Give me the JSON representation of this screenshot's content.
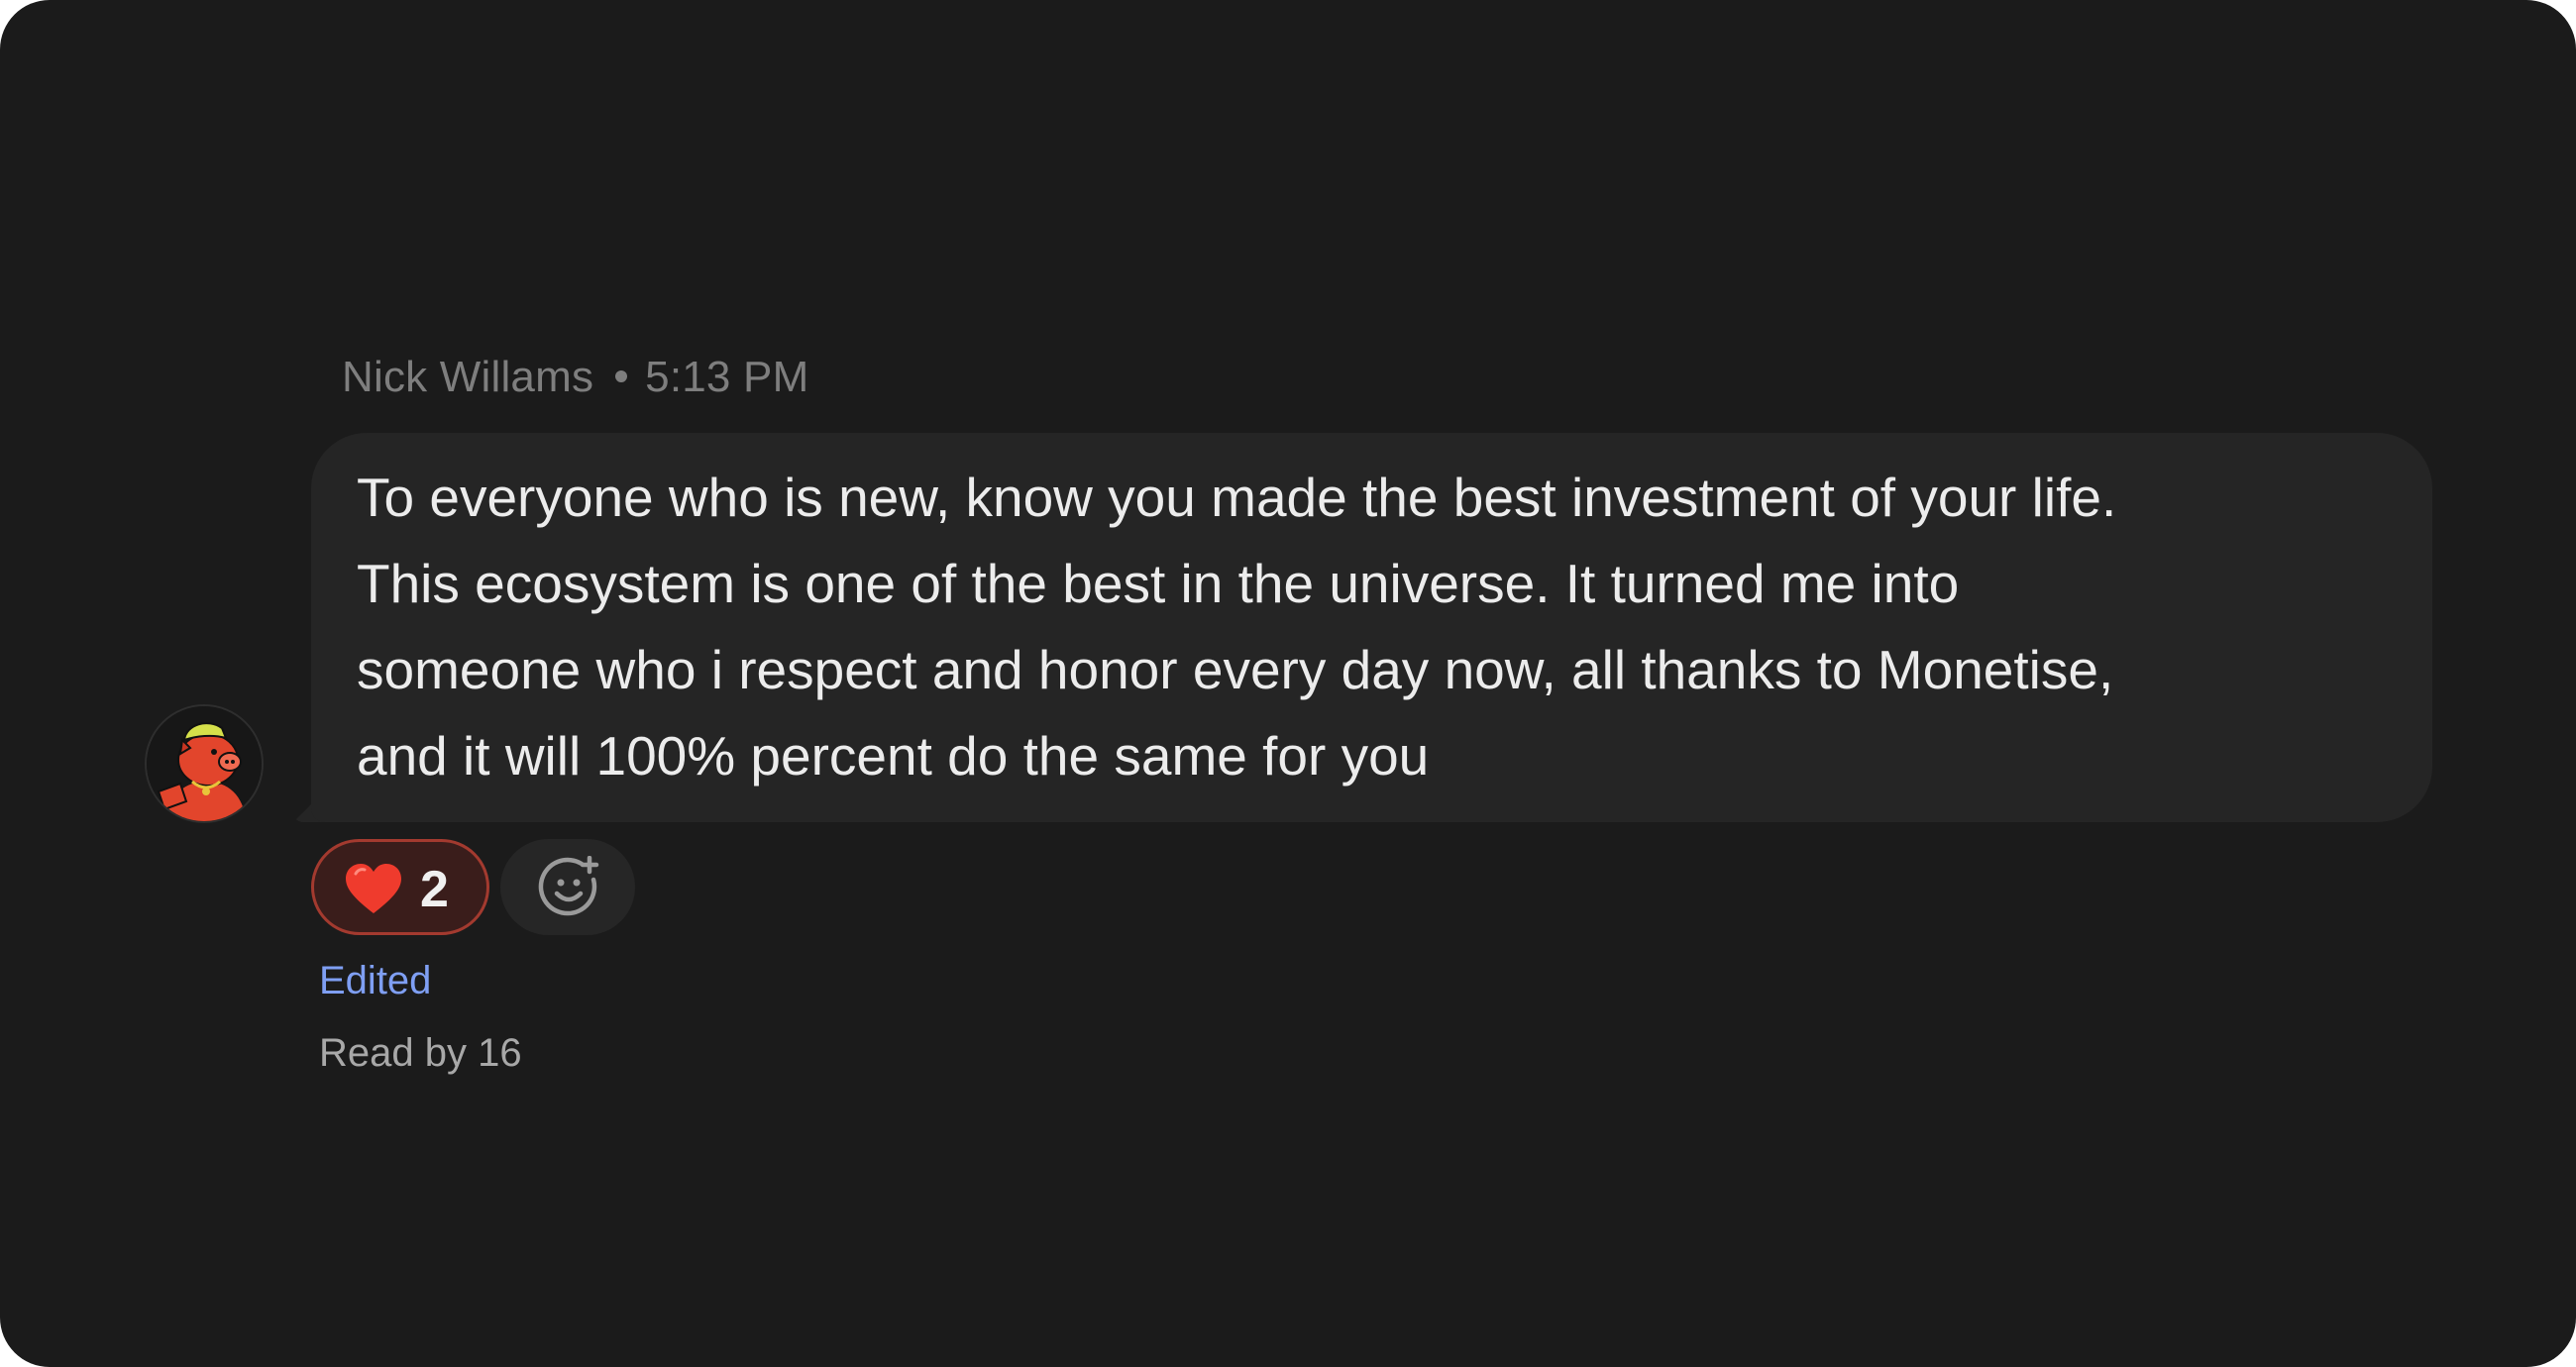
{
  "message": {
    "author": "Nick Willams",
    "time": "5:13 PM",
    "lines": [
      "To everyone who is new, know you made the best investment of your life.",
      "This ecosystem is one of the best in the universe. It turned me into",
      "someone who i respect and honor every day now, all thanks to Monetise,",
      "and it will 100% percent do the same for you"
    ]
  },
  "reactions": [
    {
      "icon": "heart-emoji-icon",
      "count": "2"
    }
  ],
  "add_reaction": {
    "icon": "add-emoji-icon"
  },
  "status": {
    "edited": "Edited",
    "read_by": "Read by 16"
  },
  "colors": {
    "background": "#1b1b1b",
    "bubble": "#252525",
    "reaction_active_bg": "#3a1d1b",
    "reaction_active_border": "#a33a2f",
    "edited_link": "#7f9ff3"
  }
}
